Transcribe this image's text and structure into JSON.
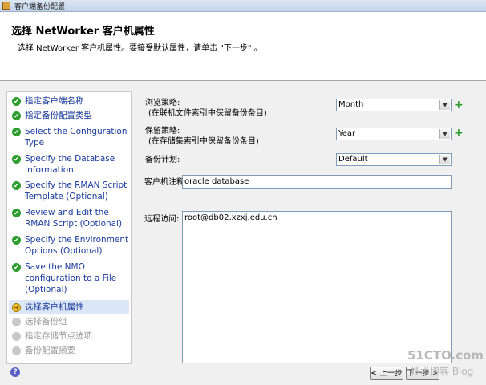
{
  "window": {
    "title": "客户端备份配置"
  },
  "header": {
    "title": "选择 NetWorker 客户机属性",
    "subtitle": "选择 NetWorker 客户机属性。要接受默认属性，请单击 \"下一步\" 。"
  },
  "steps": [
    {
      "label": "指定客户端名称",
      "status": "done"
    },
    {
      "label": "指定备份配置类型",
      "status": "done"
    },
    {
      "label": "Select the Configuration Type",
      "status": "done"
    },
    {
      "label": "Specify the Database Information",
      "status": "done"
    },
    {
      "label": "Specify the RMAN Script Template (Optional)",
      "status": "done"
    },
    {
      "label": "Review and Edit the RMAN Script (Optional)",
      "status": "done"
    },
    {
      "label": "Specify the Environment Options (Optional)",
      "status": "done"
    },
    {
      "label": "Save the NMO configuration to a File (Optional)",
      "status": "done"
    },
    {
      "label": "选择客户机属性",
      "status": "current"
    },
    {
      "label": "选择备份组",
      "status": "pending"
    },
    {
      "label": "指定存储节点选项",
      "status": "pending"
    },
    {
      "label": "备份配置摘要",
      "status": "pending"
    }
  ],
  "form": {
    "browse_policy": {
      "label": "浏览策略:",
      "hint": "(在联机文件索引中保留备份条目)",
      "value": "Month"
    },
    "retention_policy": {
      "label": "保留策略:",
      "hint": "(在存储集索引中保留备份条目)",
      "value": "Year"
    },
    "schedule": {
      "label": "备份计划:",
      "value": "Default"
    },
    "comment": {
      "label": "客户机注释:",
      "value": "oracle database"
    },
    "remote_access": {
      "label": "远程访问:",
      "value": "root@db02.xzxj.edu.cn"
    }
  },
  "buttons": {
    "back": "< 上一步",
    "next": "下一步 >"
  },
  "watermark": {
    "line1": "51CTO.com",
    "line2": "技术博客 Blog"
  },
  "colors": {
    "step_link": "#1a3b9c",
    "done": "#2d9d2d",
    "current_bg": "#dbe6f7"
  }
}
